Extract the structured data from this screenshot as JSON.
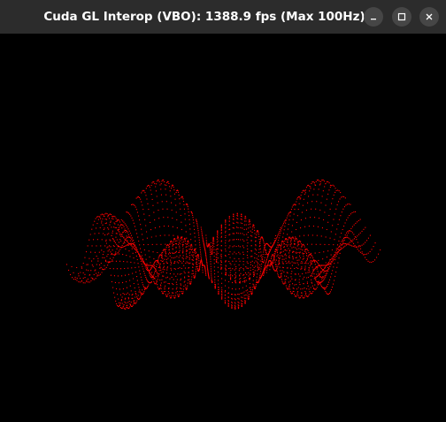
{
  "window": {
    "title": "Cuda GL Interop (VBO): 1388.9 fps (Max 100Hz)"
  },
  "controls": {
    "minimize_icon": "minimize-icon",
    "maximize_icon": "maximize-icon",
    "close_icon": "close-icon"
  },
  "render": {
    "point_color": "#ff0000",
    "background_color": "#000000"
  },
  "colors": {
    "titlebar_bg": "#2c2c2c",
    "button_bg": "#464646",
    "title_text": "#ffffff"
  }
}
